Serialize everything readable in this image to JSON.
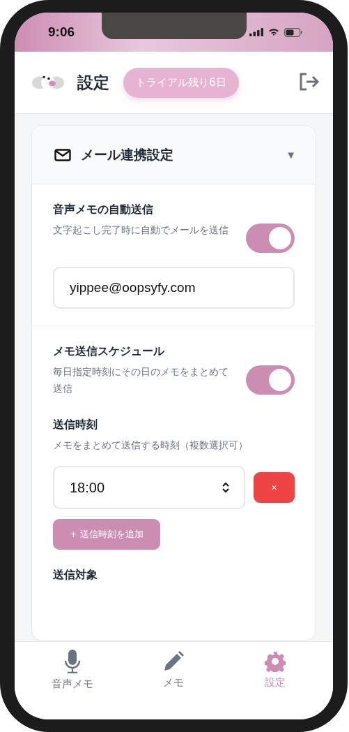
{
  "status_bar": {
    "time": "9:06"
  },
  "header": {
    "title": "設定",
    "trial_badge": "トライアル残り6日"
  },
  "section": {
    "title": "メール連携設定",
    "expanded": true,
    "toggle_glyph": "▼"
  },
  "auto_send": {
    "title": "音声メモの自動送信",
    "description": "文字起こし完了時に自動でメールを送信",
    "on": true,
    "email": "yippee@oopsyfy.com"
  },
  "schedule": {
    "title": "メモ送信スケジュール",
    "description": "毎日指定時刻にその日のメモをまとめて送信",
    "on": true
  },
  "send_times": {
    "title": "送信時刻",
    "description": "メモをまとめて送信する時刻（複数選択可）",
    "times": [
      {
        "value": "18:00",
        "remove": "×"
      }
    ],
    "add_button": "+ 送信時刻を追加"
  },
  "send_target": {
    "title": "送信対象"
  },
  "tab_bar": [
    {
      "label": "音声メモ",
      "kind": "mic",
      "selected": false
    },
    {
      "label": "メモ",
      "kind": "pencil",
      "selected": false
    },
    {
      "label": "設定",
      "kind": "gear",
      "selected": true
    }
  ]
}
